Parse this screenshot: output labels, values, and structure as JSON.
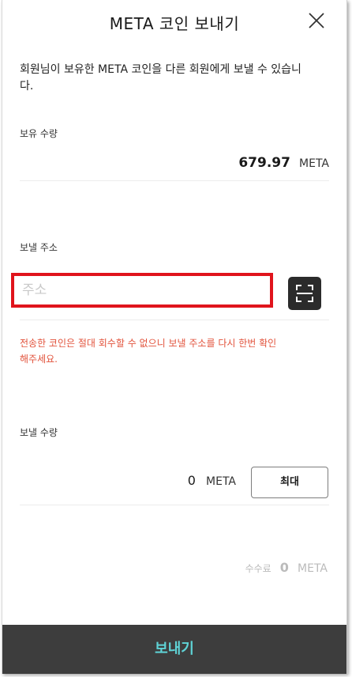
{
  "header": {
    "title": "META 코인 보내기"
  },
  "description": "회원님이 보유한 META 코인을 다른 회원에게 보낼 수 있습니다.",
  "balance": {
    "label": "보유 수량",
    "value": "679.97",
    "unit": "META"
  },
  "address": {
    "label": "보낼 주소",
    "placeholder": "주소",
    "value": "",
    "highlight_color": "#e0141c"
  },
  "warning": "전송한 코인은 절대 회수할 수 없으니 보낼 주소를 다시 한번 확인해주세요.",
  "amount": {
    "label": "보낼 수량",
    "value": "0",
    "unit": "META",
    "max_label": "최대"
  },
  "fee": {
    "label": "수수료",
    "value": "0",
    "unit": "META"
  },
  "footer": {
    "send_label": "보내기"
  },
  "colors": {
    "accent": "#5fd3d6",
    "warning": "#e2533c",
    "footer_bg": "#3d3d3d"
  },
  "icons": {
    "close": "close-icon",
    "scan": "qr-scan-icon"
  }
}
